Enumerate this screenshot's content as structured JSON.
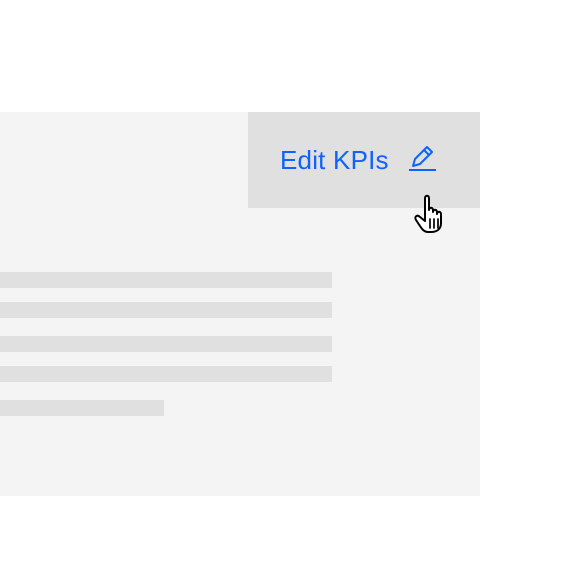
{
  "card": {
    "action": {
      "label": "Edit KPIs",
      "icon": "pencil-icon"
    },
    "content": {
      "skeleton_line_count": 5
    }
  },
  "cursor": {
    "icon": "hand-pointer-icon"
  },
  "colors": {
    "link": "#0f62fe",
    "card_background": "#f4f4f4",
    "action_background": "#e0e0e0",
    "skeleton": "#e0e0e0"
  }
}
